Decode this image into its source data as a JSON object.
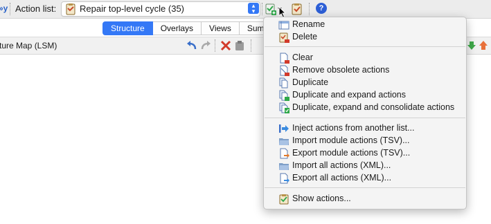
{
  "toolbar": {
    "cut_text": "»y",
    "action_list_label": "Action list:",
    "action_list_value": "Repair top-level cycle (35)",
    "help_label": "?"
  },
  "tabs": [
    {
      "label": "Structure",
      "active": true
    },
    {
      "label": "Overlays",
      "active": false
    },
    {
      "label": "Views",
      "active": false
    },
    {
      "label": "Summ",
      "active": false
    }
  ],
  "subbar": {
    "title": "ture Map (LSM)"
  },
  "menu": {
    "items": [
      {
        "label": "Rename",
        "icon": "rename-icon"
      },
      {
        "label": "Delete",
        "icon": "delete-list-icon"
      },
      {
        "label": "Clear",
        "icon": "clear-icon"
      },
      {
        "label": "Remove obsolete actions",
        "icon": "remove-obsolete-icon"
      },
      {
        "label": "Duplicate",
        "icon": "duplicate-icon"
      },
      {
        "label": "Duplicate and expand actions",
        "icon": "duplicate-expand-icon"
      },
      {
        "label": "Duplicate, expand and consolidate actions",
        "icon": "duplicate-consolidate-icon"
      },
      {
        "label": "Inject actions from another list...",
        "icon": "inject-icon"
      },
      {
        "label": "Import module actions (TSV)...",
        "icon": "folder-open-icon"
      },
      {
        "label": "Export module actions (TSV)...",
        "icon": "export-icon"
      },
      {
        "label": "Import all actions (XML)...",
        "icon": "folder-open-icon"
      },
      {
        "label": "Export all actions (XML)...",
        "icon": "export-icon"
      },
      {
        "label": "Show actions...",
        "icon": "show-actions-icon"
      }
    ]
  },
  "colors": {
    "accent": "#3478f6",
    "danger": "#d23a2a",
    "success": "#2fa84a"
  }
}
